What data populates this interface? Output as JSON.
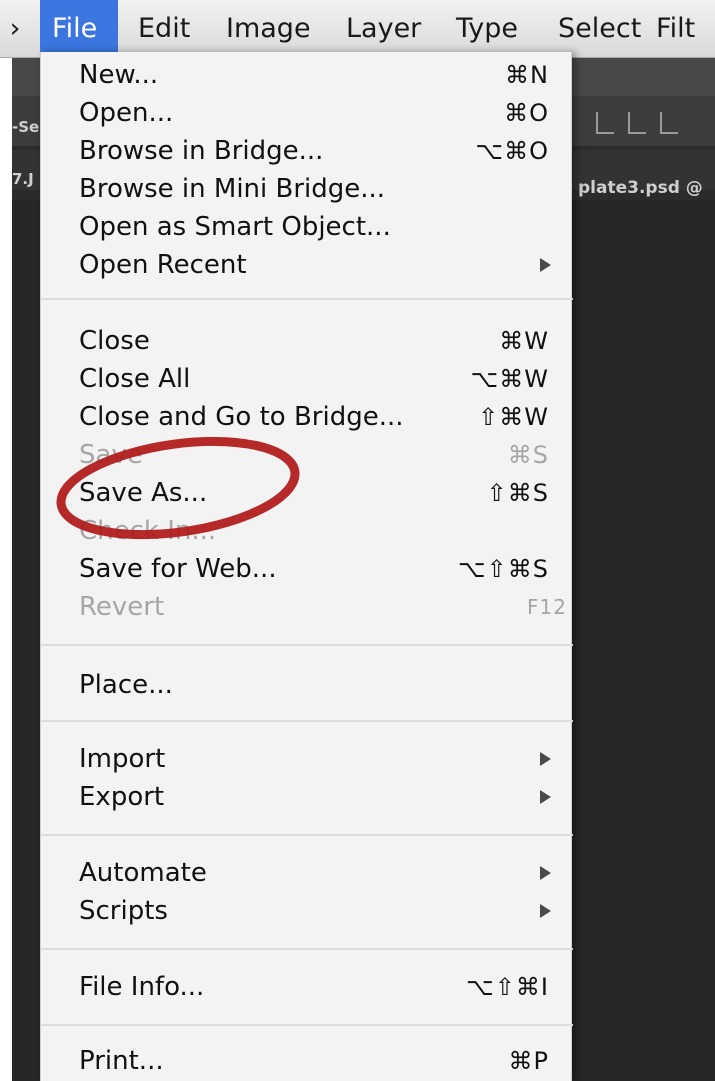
{
  "menubar": {
    "items": [
      {
        "label": "File",
        "active": true
      },
      {
        "label": "Edit"
      },
      {
        "label": "Image"
      },
      {
        "label": "Layer"
      },
      {
        "label": "Type"
      },
      {
        "label": "Select"
      },
      {
        "label": "Filt"
      }
    ]
  },
  "background": {
    "left_text_1": "-Se",
    "left_text_2": "7.J",
    "doc_tab": "plate3.psd @"
  },
  "file_menu": {
    "new": {
      "label": "New...",
      "shortcut": "⌘N"
    },
    "open": {
      "label": "Open...",
      "shortcut": "⌘O"
    },
    "browse_bridge": {
      "label": "Browse in Bridge...",
      "shortcut": "⌥⌘O"
    },
    "browse_mini_bridge": {
      "label": "Browse in Mini Bridge..."
    },
    "open_smart_object": {
      "label": "Open as Smart Object..."
    },
    "open_recent": {
      "label": "Open Recent"
    },
    "close": {
      "label": "Close",
      "shortcut": "⌘W"
    },
    "close_all": {
      "label": "Close All",
      "shortcut": "⌥⌘W"
    },
    "close_go_bridge": {
      "label": "Close and Go to Bridge...",
      "shortcut": "⇧⌘W"
    },
    "save": {
      "label": "Save",
      "shortcut": "⌘S",
      "disabled": true
    },
    "save_as": {
      "label": "Save As...",
      "shortcut": "⇧⌘S"
    },
    "check_in": {
      "label": "Check In...",
      "disabled": true
    },
    "save_for_web": {
      "label": "Save for Web...",
      "shortcut": "⌥⇧⌘S"
    },
    "revert": {
      "label": "Revert",
      "shortcut": "F12",
      "disabled": true
    },
    "place": {
      "label": "Place..."
    },
    "import": {
      "label": "Import"
    },
    "export": {
      "label": "Export"
    },
    "automate": {
      "label": "Automate"
    },
    "scripts": {
      "label": "Scripts"
    },
    "file_info": {
      "label": "File Info...",
      "shortcut": "⌥⇧⌘I"
    },
    "print": {
      "label": "Print...",
      "shortcut": "⌘P"
    }
  },
  "colors": {
    "menu_highlight": "#3b76e0",
    "annotation": "#b01818"
  }
}
